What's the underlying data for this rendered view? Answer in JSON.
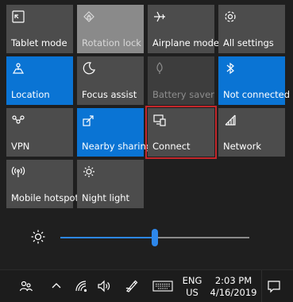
{
  "tiles": [
    {
      "label": "Tablet mode",
      "icon": "tablet-mode-icon",
      "state": "off"
    },
    {
      "label": "Rotation lock",
      "icon": "rotation-lock-icon",
      "state": "light"
    },
    {
      "label": "Airplane mode",
      "icon": "airplane-icon",
      "state": "off"
    },
    {
      "label": "All settings",
      "icon": "gear-icon",
      "state": "off"
    },
    {
      "label": "Location",
      "icon": "location-icon",
      "state": "on"
    },
    {
      "label": "Focus assist",
      "icon": "moon-icon",
      "state": "off"
    },
    {
      "label": "Battery saver",
      "icon": "battery-saver-icon",
      "state": "disabled"
    },
    {
      "label": "Not connected",
      "icon": "bluetooth-icon",
      "state": "on"
    },
    {
      "label": "VPN",
      "icon": "vpn-icon",
      "state": "off"
    },
    {
      "label": "Nearby sharing",
      "icon": "nearby-sharing-icon",
      "state": "on"
    },
    {
      "label": "Connect",
      "icon": "connect-icon",
      "state": "off",
      "selected": true
    },
    {
      "label": "Network",
      "icon": "network-icon",
      "state": "off"
    },
    {
      "label": "Mobile hotspot",
      "icon": "mobile-hotspot-icon",
      "state": "off"
    },
    {
      "label": "Night light",
      "icon": "night-light-icon",
      "state": "off"
    }
  ],
  "brightness": {
    "icon": "brightness-icon",
    "level_percent": 50
  },
  "taskbar": {
    "lang_line1": "ENG",
    "lang_line2": "US",
    "time": "2:03 PM",
    "date": "4/16/2019"
  },
  "colors": {
    "accent": "#0a74d4",
    "tile": "#4c4c4c",
    "highlight": "#c4272b"
  }
}
